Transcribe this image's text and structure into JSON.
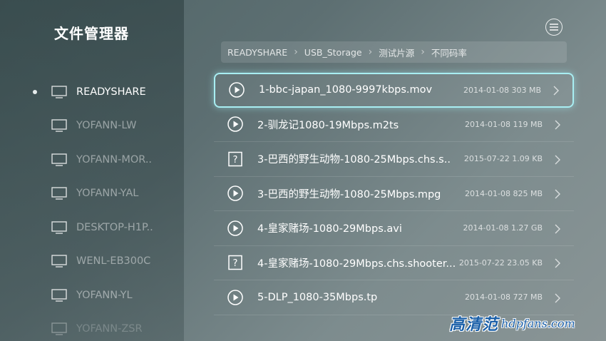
{
  "app": {
    "title": "文件管理器"
  },
  "devices": [
    {
      "label": "READYSHARE",
      "active": true
    },
    {
      "label": "YOFANN-LW",
      "active": false
    },
    {
      "label": "YOFANN-MOR..",
      "active": false
    },
    {
      "label": "YOFANN-YAL",
      "active": false
    },
    {
      "label": "DESKTOP-H1P..",
      "active": false
    },
    {
      "label": "WENL-EB300C",
      "active": false
    },
    {
      "label": "YOFANN-YL",
      "active": false
    },
    {
      "label": "YOFANN-ZSR",
      "active": false
    }
  ],
  "breadcrumb": [
    "READYSHARE",
    "USB_Storage",
    "测试片源",
    "不同码率"
  ],
  "files": [
    {
      "name": "1-bbc-japan_1080-9997kbps.mov",
      "meta": "2014-01-08 303 MB",
      "icon": "play-icon"
    },
    {
      "name": "2-驯龙记1080-19Mbps.m2ts",
      "meta": "2014-01-08 119 MB",
      "icon": "play-icon"
    },
    {
      "name": "3-巴西的野生动物-1080-25Mbps.chs.s..",
      "meta": "2015-07-22 1.09 KB",
      "icon": "unknown-file-icon"
    },
    {
      "name": "3-巴西的野生动物-1080-25Mbps.mpg",
      "meta": "2014-01-08 825 MB",
      "icon": "play-icon"
    },
    {
      "name": "4-皇家赌场-1080-29Mbps.avi",
      "meta": "2014-01-08 1.27 GB",
      "icon": "play-icon"
    },
    {
      "name": "4-皇家赌场-1080-29Mbps.chs.shooter...",
      "meta": "2015-07-22 23.05 KB",
      "icon": "unknown-file-icon"
    },
    {
      "name": "5-DLP_1080-35Mbps.tp",
      "meta": "2014-01-08 727 MB",
      "icon": "play-icon"
    }
  ],
  "watermark": {
    "cn": "高清范",
    "en": "hdpfans.com"
  },
  "colors": {
    "selection": "#a8eef2"
  }
}
